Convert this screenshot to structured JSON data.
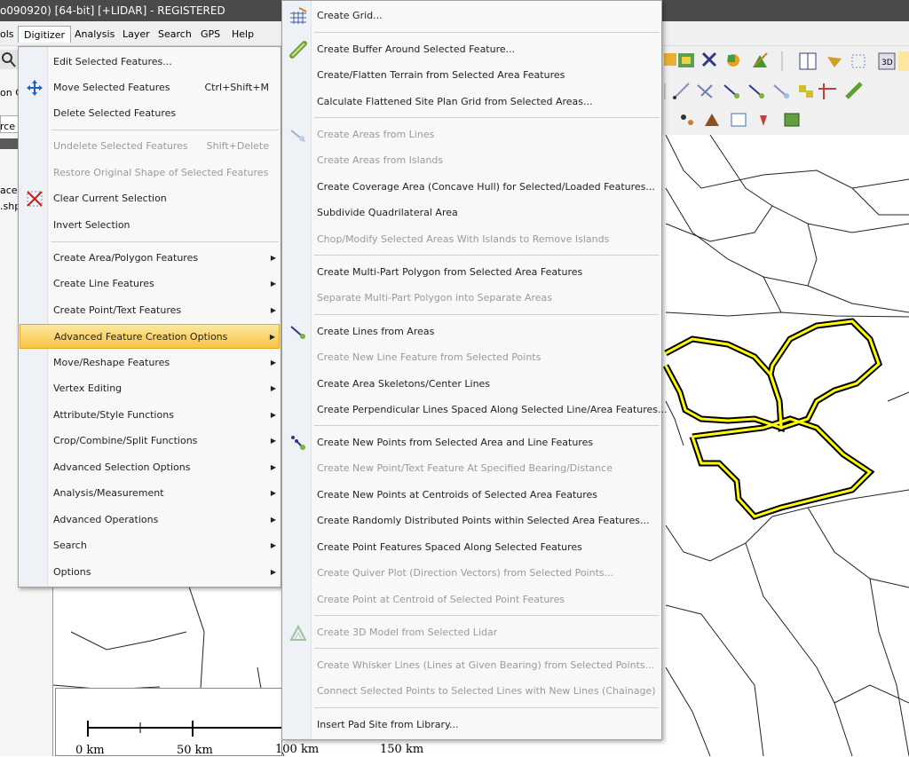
{
  "window": {
    "title": "o090920) [64-bit] [+LIDAR] - REGISTERED"
  },
  "menubar": {
    "items": [
      "ols",
      "Digitizer",
      "Analysis",
      "Layer",
      "Search",
      "GPS",
      "Help"
    ]
  },
  "left_panel": {
    "frag1": "on C",
    "frag2": "rce I",
    "frag3": "ace",
    "frag4": ".shp"
  },
  "digitizer_menu": {
    "items": [
      {
        "label": "Edit Selected Features...",
        "shortcut": "",
        "disabled": false
      },
      {
        "label": "Move Selected Features",
        "shortcut": "Ctrl+Shift+M",
        "disabled": false
      },
      {
        "label": "Delete Selected Features",
        "shortcut": "",
        "disabled": false
      },
      {
        "label": "Undelete Selected Features",
        "shortcut": "Shift+Delete",
        "disabled": true
      },
      {
        "label": "Restore Original Shape of Selected Features",
        "shortcut": "",
        "disabled": true
      },
      {
        "label": "Clear Current Selection",
        "shortcut": "",
        "disabled": false
      },
      {
        "label": "Invert Selection",
        "shortcut": "",
        "disabled": false
      },
      {
        "label": "Create Area/Polygon Features",
        "shortcut": "",
        "disabled": false
      },
      {
        "label": "Create Line Features",
        "shortcut": "",
        "disabled": false
      },
      {
        "label": "Create Point/Text Features",
        "shortcut": "",
        "disabled": false
      },
      {
        "label": "Advanced Feature Creation Options",
        "shortcut": "",
        "disabled": false
      },
      {
        "label": "Move/Reshape Features",
        "shortcut": "",
        "disabled": false
      },
      {
        "label": "Vertex Editing",
        "shortcut": "",
        "disabled": false
      },
      {
        "label": "Attribute/Style Functions",
        "shortcut": "",
        "disabled": false
      },
      {
        "label": "Crop/Combine/Split Functions",
        "shortcut": "",
        "disabled": false
      },
      {
        "label": "Advanced Selection Options",
        "shortcut": "",
        "disabled": false
      },
      {
        "label": "Analysis/Measurement",
        "shortcut": "",
        "disabled": false
      },
      {
        "label": "Advanced Operations",
        "shortcut": "",
        "disabled": false
      },
      {
        "label": "Search",
        "shortcut": "",
        "disabled": false
      },
      {
        "label": "Options",
        "shortcut": "",
        "disabled": false
      }
    ]
  },
  "advanced_menu": {
    "items": [
      {
        "label": "Create Grid...",
        "disabled": false
      },
      {
        "label": "Create Buffer Around Selected Feature...",
        "disabled": false
      },
      {
        "label": "Create/Flatten Terrain from Selected Area Features",
        "disabled": false
      },
      {
        "label": "Calculate Flattened Site Plan Grid from Selected Areas...",
        "disabled": false
      },
      {
        "label": "Create Areas from Lines",
        "disabled": true
      },
      {
        "label": "Create Areas from Islands",
        "disabled": true
      },
      {
        "label": "Create Coverage Area (Concave Hull) for Selected/Loaded Features...",
        "disabled": false
      },
      {
        "label": "Subdivide Quadrilateral Area",
        "disabled": false
      },
      {
        "label": "Chop/Modify Selected Areas With Islands to Remove Islands",
        "disabled": true
      },
      {
        "label": "Create Multi-Part Polygon from Selected Area Features",
        "disabled": false
      },
      {
        "label": "Separate Multi-Part Polygon into Separate Areas",
        "disabled": true
      },
      {
        "label": "Create Lines from Areas",
        "disabled": false
      },
      {
        "label": "Create New Line Feature from Selected Points",
        "disabled": true
      },
      {
        "label": "Create Area Skeletons/Center Lines",
        "disabled": false
      },
      {
        "label": "Create Perpendicular Lines Spaced Along Selected Line/Area Features...",
        "disabled": false
      },
      {
        "label": "Create New Points from Selected Area and Line Features",
        "disabled": false
      },
      {
        "label": "Create New Point/Text Feature At Specified Bearing/Distance",
        "disabled": true
      },
      {
        "label": "Create New Points at Centroids of Selected Area Features",
        "disabled": false
      },
      {
        "label": "Create Randomly Distributed Points within Selected Area Features...",
        "disabled": false
      },
      {
        "label": "Create Point Features Spaced Along Selected Features",
        "disabled": false
      },
      {
        "label": "Create Quiver Plot (Direction Vectors) from Selected Points...",
        "disabled": true
      },
      {
        "label": "Create Point at Centroid of Selected Point Features",
        "disabled": true
      },
      {
        "label": "Create 3D Model from Selected Lidar",
        "disabled": true
      },
      {
        "label": "Create Whisker Lines (Lines at Given Bearing) from Selected Points...",
        "disabled": true
      },
      {
        "label": "Connect Selected Points to Selected Lines with New Lines (Chainage)",
        "disabled": true
      },
      {
        "label": "Insert Pad Site from Library...",
        "disabled": false
      }
    ]
  },
  "scale": {
    "labels": [
      "0 km",
      "50 km",
      "100 km",
      "150 km"
    ]
  },
  "colors": {
    "highlight": "#f7c444",
    "selection": "#ffff00"
  }
}
